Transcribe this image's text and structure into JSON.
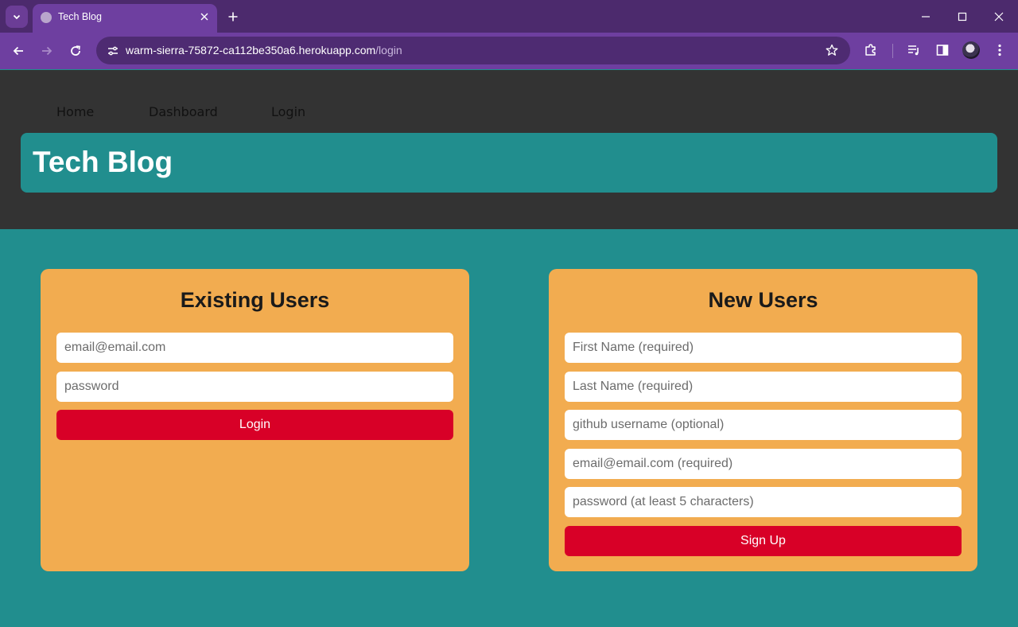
{
  "browser": {
    "tab_title": "Tech Blog",
    "url_host": "warm-sierra-75872-ca112be350a6.herokuapp.com",
    "url_path": "/login",
    "theme_colors": {
      "frame": "#4c2a6d",
      "toolbar": "#6e3fa0",
      "omnibox": "#4e2b72"
    }
  },
  "site": {
    "nav": {
      "home": "Home",
      "dashboard": "Dashboard",
      "login": "Login"
    },
    "title": "Tech Blog",
    "colors": {
      "header_bg": "#333333",
      "accent": "#218e8e",
      "card": "#f2ac50",
      "button": "#d80027"
    }
  },
  "login_form": {
    "heading": "Existing Users",
    "email_placeholder": "email@email.com",
    "password_placeholder": "password",
    "submit_label": "Login"
  },
  "signup_form": {
    "heading": "New Users",
    "first_name_placeholder": "First Name (required)",
    "last_name_placeholder": "Last Name (required)",
    "github_placeholder": "github username (optional)",
    "email_placeholder": "email@email.com (required)",
    "password_placeholder": "password (at least 5 characters)",
    "submit_label": "Sign Up"
  }
}
